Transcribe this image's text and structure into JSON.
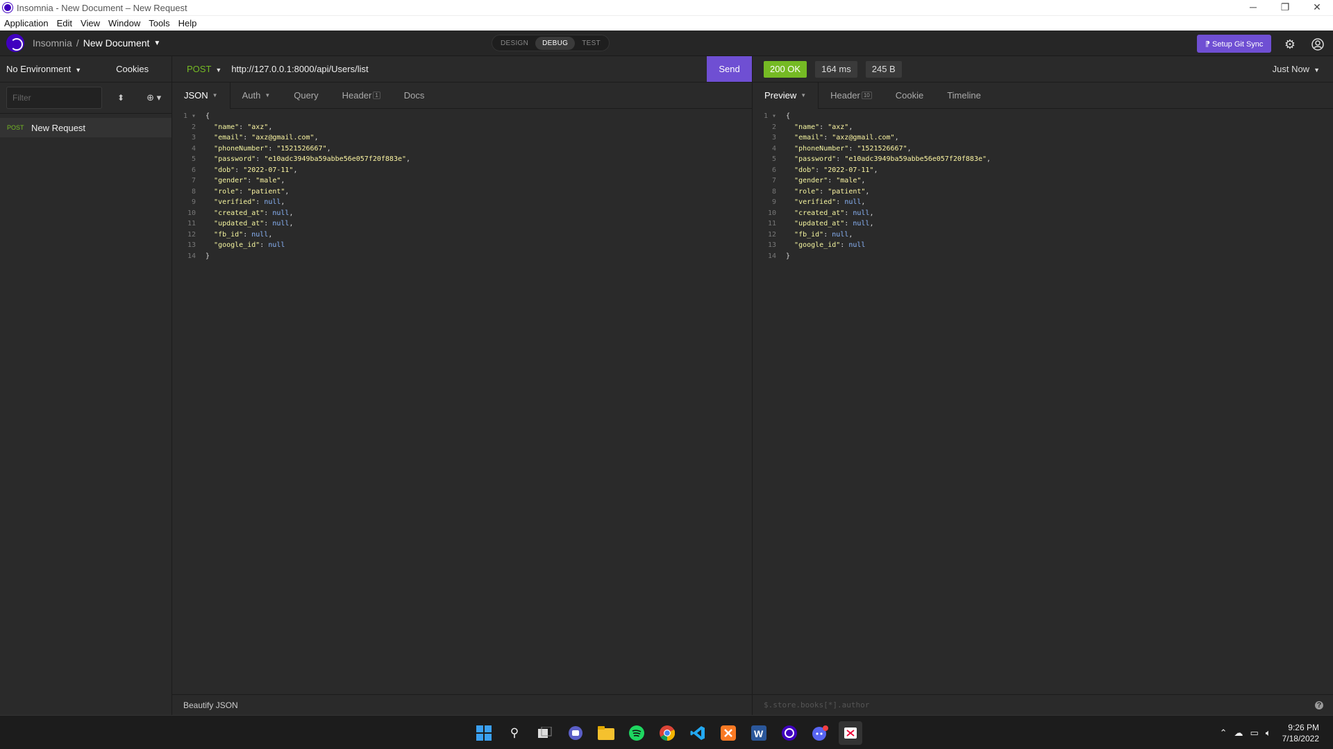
{
  "window": {
    "title": "Insomnia - New Document – New Request",
    "controls": [
      "─",
      "❐",
      "✕"
    ]
  },
  "menu": [
    "Application",
    "Edit",
    "View",
    "Window",
    "Tools",
    "Help"
  ],
  "header": {
    "workspace": "Insomnia",
    "separator": "/",
    "document": "New Document",
    "modes": [
      "DESIGN",
      "DEBUG",
      "TEST"
    ],
    "active_mode": "DEBUG",
    "git_sync": "⁋ Setup Git Sync"
  },
  "sidebar": {
    "environment": "No Environment",
    "cookies": "Cookies",
    "filter_placeholder": "Filter",
    "requests": [
      {
        "method": "POST",
        "name": "New Request"
      }
    ]
  },
  "request": {
    "method": "POST",
    "url": "http://127.0.0.1:8000/api/Users/list",
    "send_label": "Send",
    "tabs": [
      "JSON",
      "Auth",
      "Query",
      "Header",
      "Docs"
    ],
    "header_count": "1",
    "footer": "Beautify JSON"
  },
  "response": {
    "status": "200 OK",
    "time": "164 ms",
    "size": "245 B",
    "when": "Just Now",
    "tabs": [
      "Preview",
      "Header",
      "Cookie",
      "Timeline"
    ],
    "header_count": "10",
    "filter_placeholder": "$.store.books[*].author",
    "help": "?"
  },
  "json_lines": [
    {
      "t": "brace",
      "v": "{"
    },
    {
      "t": "str",
      "key": "name",
      "val": "axz"
    },
    {
      "t": "str",
      "key": "email",
      "val": "axz@gmail.com"
    },
    {
      "t": "str",
      "key": "phoneNumber",
      "val": "1521526667"
    },
    {
      "t": "str",
      "key": "password",
      "val": "e10adc3949ba59abbe56e057f20f883e"
    },
    {
      "t": "str",
      "key": "dob",
      "val": "2022-07-11"
    },
    {
      "t": "str",
      "key": "gender",
      "val": "male"
    },
    {
      "t": "str",
      "key": "role",
      "val": "patient"
    },
    {
      "t": "null",
      "key": "verified",
      "val": "null"
    },
    {
      "t": "null",
      "key": "created_at",
      "val": "null"
    },
    {
      "t": "null",
      "key": "updated_at",
      "val": "null"
    },
    {
      "t": "null",
      "key": "fb_id",
      "val": "null"
    },
    {
      "t": "null",
      "key": "google_id",
      "val": "null",
      "last": true
    },
    {
      "t": "brace",
      "v": "}"
    }
  ],
  "taskbar": {
    "apps": [
      "start",
      "search",
      "task-view",
      "teams",
      "file-explorer",
      "spotify",
      "chrome",
      "vscode",
      "xampp",
      "word",
      "insomnia",
      "discord",
      "snipping-tool"
    ],
    "time": "9:26 PM",
    "date": "7/18/2022"
  }
}
